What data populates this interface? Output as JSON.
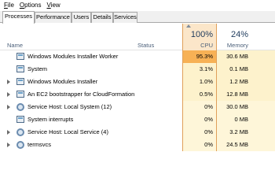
{
  "menu": [
    {
      "accel": "F",
      "rest": "ile"
    },
    {
      "accel": "O",
      "rest": "ptions"
    },
    {
      "accel": "V",
      "rest": "iew"
    }
  ],
  "tabs": [
    "Processes",
    "Performance",
    "Users",
    "Details",
    "Services"
  ],
  "active_tab": "Processes",
  "header": {
    "name": "Name",
    "status": "Status",
    "cpu_pct": "100%",
    "cpu_label": "CPU",
    "mem_pct": "24%",
    "mem_label": "Memory",
    "sort_indicator": "sort-up-arrow"
  },
  "colors": {
    "cpu_column_border": "#e0a05a",
    "cpu_header_bg": "#fbe6c9",
    "row_heat_high": "#f7b155",
    "row_heat_low": "#fdf2cc",
    "row_heat_lower": "#fef6d9"
  },
  "processes": [
    {
      "name": "Windows Modules Installer Worker",
      "cpu": "95.3%",
      "memory": "30.6 MB",
      "expandable": false,
      "icon": "app-window-icon",
      "heat": "high"
    },
    {
      "name": "System",
      "cpu": "3.1%",
      "memory": "0.1 MB",
      "expandable": false,
      "icon": "app-window-icon",
      "heat": "low"
    },
    {
      "name": "Windows Modules Installer",
      "cpu": "1.0%",
      "memory": "1.2 MB",
      "expandable": true,
      "icon": "app-window-icon",
      "heat": "low"
    },
    {
      "name": "An EC2 bootstrapper for CloudFormation",
      "cpu": "0.5%",
      "memory": "12.8 MB",
      "expandable": true,
      "icon": "app-window-icon",
      "heat": "low"
    },
    {
      "name": "Service Host: Local System (12)",
      "cpu": "0%",
      "memory": "30.0 MB",
      "expandable": true,
      "icon": "gear-icon",
      "heat": "lower"
    },
    {
      "name": "System interrupts",
      "cpu": "0%",
      "memory": "0 MB",
      "expandable": false,
      "icon": "app-window-icon",
      "heat": "lower"
    },
    {
      "name": "Service Host: Local Service (4)",
      "cpu": "0%",
      "memory": "3.2 MB",
      "expandable": true,
      "icon": "gear-icon",
      "heat": "lower"
    },
    {
      "name": "termsvcs",
      "cpu": "0%",
      "memory": "24.5 MB",
      "expandable": true,
      "icon": "gear-icon",
      "heat": "lower"
    }
  ]
}
